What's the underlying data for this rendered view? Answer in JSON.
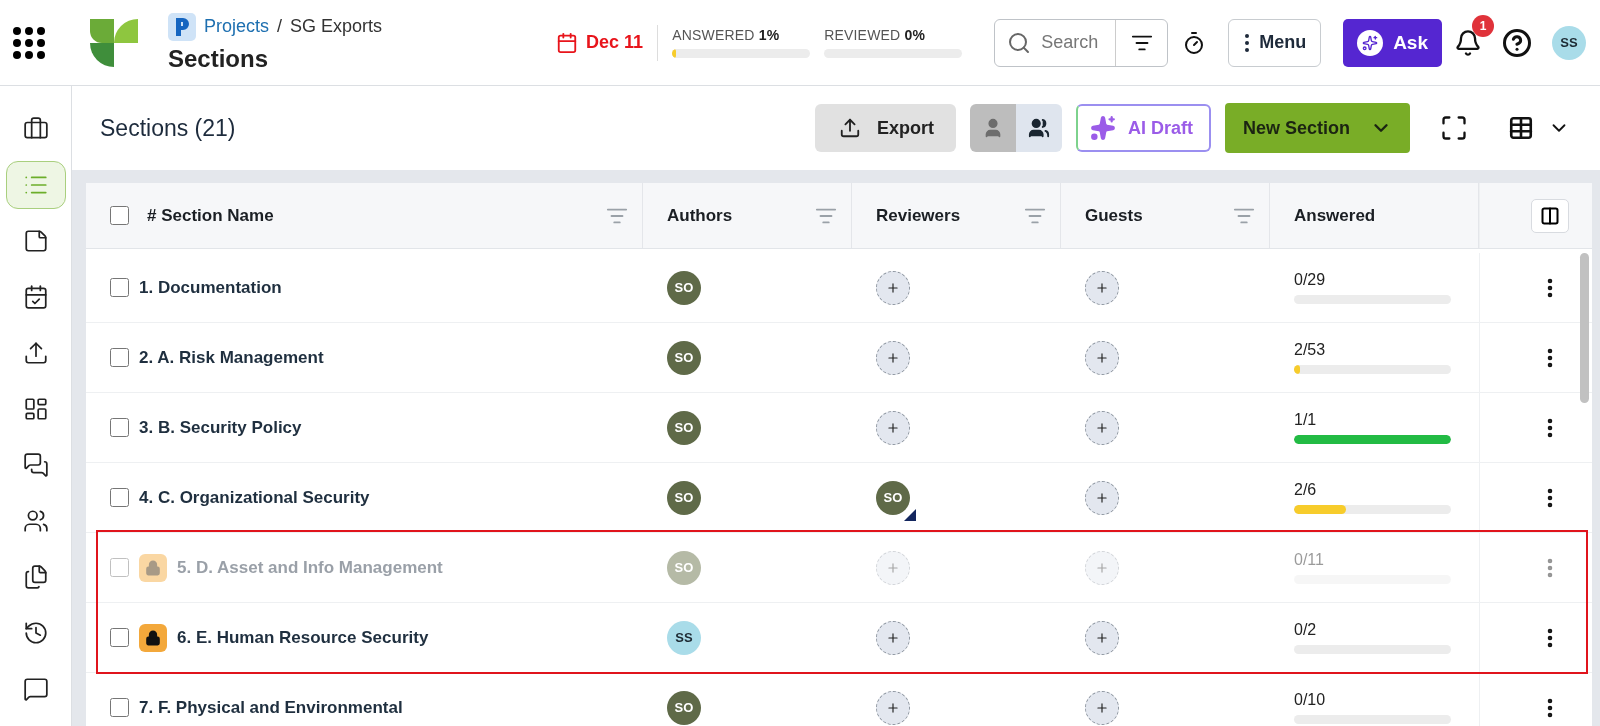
{
  "header": {
    "breadcrumb": {
      "parent": "Projects",
      "separator": "/",
      "current": "SG Exports"
    },
    "title": "Sections",
    "due_date": "Dec 11",
    "progress": [
      {
        "label": "ANSWERED",
        "value": "1%",
        "level": 0.01
      },
      {
        "label": "REVIEWED",
        "value": "0%",
        "level": 0
      }
    ],
    "search": {
      "placeholder": "Search"
    },
    "menu_button": "Menu",
    "ask_button": "Ask",
    "notifications": "1",
    "user_initials": "SS"
  },
  "sidebar": {
    "items": [
      {
        "selected": false
      },
      {
        "selected": true
      },
      {
        "selected": false
      },
      {
        "selected": false
      },
      {
        "selected": false
      },
      {
        "selected": false
      },
      {
        "selected": false
      },
      {
        "selected": false
      },
      {
        "selected": false
      },
      {
        "selected": false
      },
      {
        "selected": false
      }
    ]
  },
  "toolbar": {
    "title": "Sections (21)",
    "export_button": "Export",
    "view_toggle": [
      {
        "selected": true
      },
      {
        "selected": false
      }
    ],
    "ai_draft_button": "AI Draft",
    "new_section_button": "New Section"
  },
  "table": {
    "select_all": {
      "checked": false
    },
    "columns": [
      {
        "label": "# Section Name",
        "filter": true
      },
      {
        "label": "Authors",
        "filter": true
      },
      {
        "label": "Reviewers",
        "filter": true
      },
      {
        "label": "Guests",
        "filter": true
      },
      {
        "label": "Answered",
        "filter": false
      }
    ],
    "rows": [
      {
        "checked": false,
        "number": "1.",
        "name": "Documentation",
        "locked": false,
        "disabled": false,
        "highlighted": false,
        "authors": [
          {
            "initials": "SO",
            "color": "#5f6a48"
          }
        ],
        "reviewers": [],
        "answered": "0/29",
        "level": 0
      },
      {
        "checked": false,
        "number": "2.",
        "name": "A. Risk Management",
        "locked": false,
        "disabled": false,
        "highlighted": false,
        "authors": [
          {
            "initials": "SO",
            "color": "#5f6a48"
          }
        ],
        "reviewers": [],
        "answered": "2/53",
        "level": 0.04
      },
      {
        "checked": false,
        "number": "3.",
        "name": "B. Security Policy",
        "locked": false,
        "disabled": false,
        "highlighted": false,
        "authors": [
          {
            "initials": "SO",
            "color": "#5f6a48"
          }
        ],
        "reviewers": [],
        "answered": "1/1",
        "level": 1
      },
      {
        "checked": false,
        "number": "4.",
        "name": "C. Organizational Security",
        "locked": false,
        "disabled": false,
        "highlighted": false,
        "authors": [
          {
            "initials": "SO",
            "color": "#5f6a48"
          }
        ],
        "reviewers": [
          {
            "initials": "SO",
            "color": "#5f6a48"
          }
        ],
        "answered": "2/6",
        "level": 0.33
      },
      {
        "checked": false,
        "number": "5.",
        "name": "D. Asset and Info Management",
        "locked": true,
        "disabled": true,
        "highlighted": true,
        "authors": [
          {
            "initials": "SO",
            "color": "#b5baa6"
          }
        ],
        "reviewers": [],
        "answered": "0/11",
        "level": 0
      },
      {
        "checked": false,
        "number": "6.",
        "name": "E. Human Resource Security",
        "locked": true,
        "disabled": false,
        "highlighted": true,
        "authors": [
          {
            "initials": "SS",
            "color": "#a9dce9"
          }
        ],
        "reviewers": [],
        "answered": "0/2",
        "level": 0
      },
      {
        "checked": false,
        "number": "7.",
        "name": "F. Physical and Environmental",
        "locked": false,
        "disabled": false,
        "highlighted": false,
        "authors": [
          {
            "initials": "SO",
            "color": "#5f6a48"
          }
        ],
        "reviewers": [],
        "answered": "0/10",
        "level": 0
      }
    ]
  }
}
